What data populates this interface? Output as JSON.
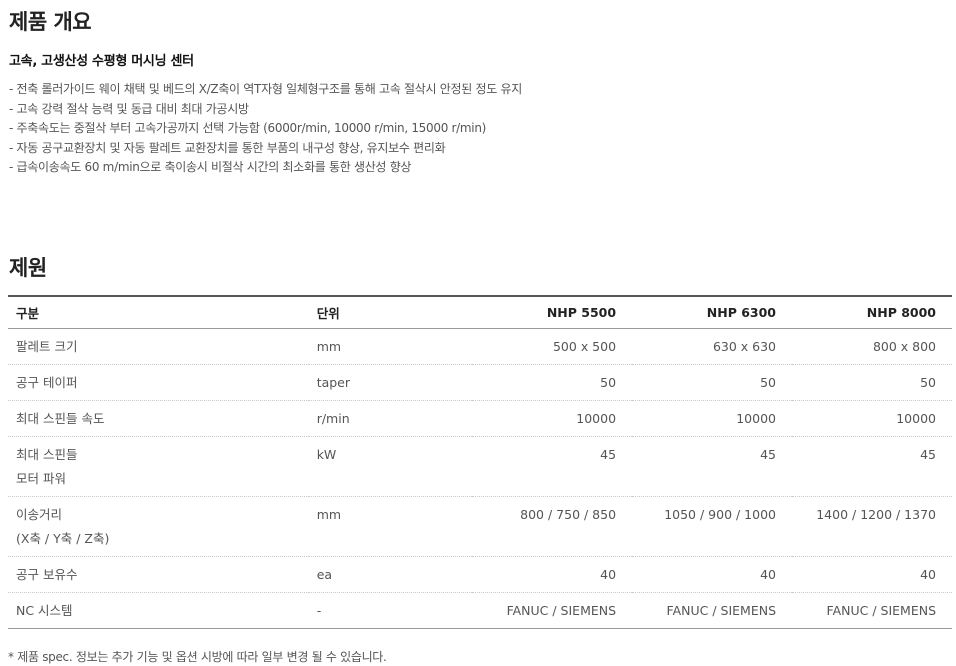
{
  "overview": {
    "title": "제품 개요",
    "subtitle": "고속, 고생산성 수평형 머시닝 센터",
    "features": [
      "- 전축 롤러가이드 웨이 채택 및 베드의 X/Z축이 역T자형 일체형구조를 통해 고속 절삭시 안정된 정도 유지",
      "- 고속 강력 절삭 능력 및 동급 대비 최대 가공시방",
      "- 주축속도는 중절삭 부터 고속가공까지 선택 가능함 (6000r/min, 10000 r/min, 15000 r/min)",
      "- 자동 공구교환장치 및 자동 팔레트 교환장치를 통한 부품의 내구성 향상, 유지보수 편리화",
      "- 급속이송속도 60 m/min으로 축이송시 비절삭 시간의 최소화를 통한 생산성 향상"
    ]
  },
  "specs": {
    "title": "제원",
    "headers": {
      "item": "구분",
      "unit": "단위",
      "models": [
        "NHP 5500",
        "NHP 6300",
        "NHP 8000"
      ]
    },
    "rows": [
      {
        "name": [
          "팔레트 크기"
        ],
        "unit": "mm",
        "values": [
          "500 x 500",
          "630 x 630",
          "800 x 800"
        ]
      },
      {
        "name": [
          "공구 테이퍼"
        ],
        "unit": "taper",
        "values": [
          "50",
          "50",
          "50"
        ]
      },
      {
        "name": [
          "최대 스핀들 속도"
        ],
        "unit": "r/min",
        "values": [
          "10000",
          "10000",
          "10000"
        ]
      },
      {
        "name": [
          "최대 스핀들",
          "모터 파워"
        ],
        "unit": "kW",
        "values": [
          "45",
          "45",
          "45"
        ]
      },
      {
        "name": [
          "이송거리",
          "(X축 / Y축 / Z축)"
        ],
        "unit": "mm",
        "values": [
          "800 / 750 / 850",
          "1050 / 900 / 1000",
          "1400 / 1200 / 1370"
        ]
      },
      {
        "name": [
          "공구 보유수"
        ],
        "unit": "ea",
        "values": [
          "40",
          "40",
          "40"
        ]
      },
      {
        "name": [
          "NC 시스템"
        ],
        "unit": "-",
        "values": [
          "FANUC / SIEMENS",
          "FANUC / SIEMENS",
          "FANUC / SIEMENS"
        ]
      }
    ],
    "note": "* 제품 spec. 정보는 추가 기능 및 옵션 시방에 따라 일부 변경 될 수 있습니다."
  }
}
